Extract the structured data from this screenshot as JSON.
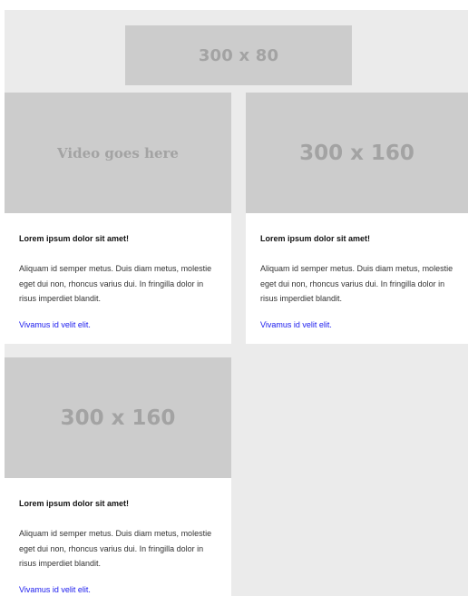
{
  "banner": {
    "label": "300 x 80"
  },
  "cards": [
    {
      "media_label": "Video goes here",
      "title": "Lorem ipsum dolor sit amet!",
      "text": "Aliquam id semper metus. Duis diam metus, molestie eget dui non, rhoncus varius dui. In fringilla dolor in risus imperdiet blandit.",
      "link": "Vivamus id velit elit."
    },
    {
      "media_label": "300 x 160",
      "title": "Lorem ipsum dolor sit amet!",
      "text": "Aliquam id semper metus. Duis diam metus, molestie eget dui non, rhoncus varius dui. In fringilla dolor in risus imperdiet blandit.",
      "link": "Vivamus id velit elit."
    },
    {
      "media_label": "300 x 160",
      "title": "Lorem ipsum dolor sit amet!",
      "text": "Aliquam id semper metus. Duis diam metus, molestie eget dui non, rhoncus varius dui. In fringilla dolor in risus imperdiet blandit.",
      "link": "Vivamus id velit elit."
    }
  ],
  "colors": {
    "background": "#ebebeb",
    "placeholder": "#cccccc",
    "placeholder_text": "#a3a3a3",
    "link": "#1a1aee"
  }
}
